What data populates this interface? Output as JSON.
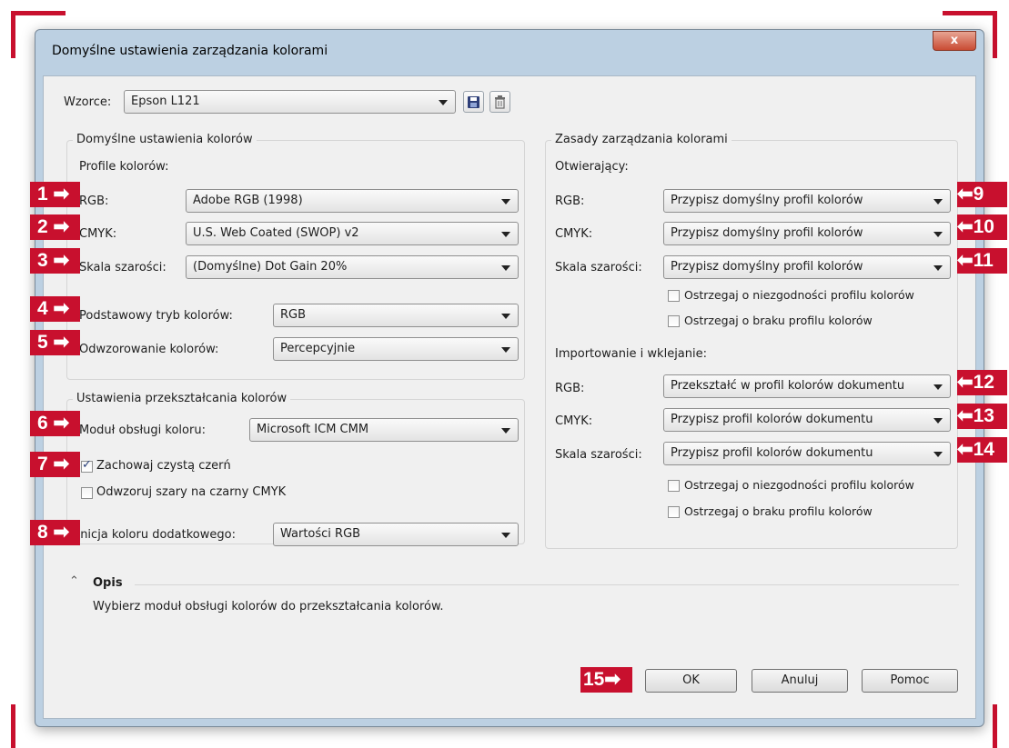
{
  "window": {
    "title": "Domyślne ustawienia zarządzania kolorami",
    "close_glyph": "x"
  },
  "preset": {
    "label": "Wzorce:",
    "value": "Epson L121",
    "save_icon": "save-icon",
    "delete_icon": "trash-icon"
  },
  "defaults_group": {
    "title": "Domyślne ustawienia kolorów",
    "profiles_label": "Profile kolorów:",
    "rgb": {
      "label": "RGB:",
      "value": "Adobe RGB (1998)"
    },
    "cmyk": {
      "label": "CMYK:",
      "value": "U.S. Web Coated (SWOP) v2"
    },
    "gray": {
      "label": "Skala szarości:",
      "value": "(Domyślne) Dot Gain 20%"
    },
    "mode": {
      "label": "Podstawowy tryb kolorów:",
      "value": "RGB"
    },
    "intent": {
      "label": "Odwzorowanie kolorów:",
      "value": "Percepcyjnie"
    }
  },
  "conversion_group": {
    "title": "Ustawienia przekształcania kolorów",
    "engine": {
      "label": "Moduł obsługi koloru:",
      "value": "Microsoft ICM CMM"
    },
    "preserve_black": {
      "label": "Zachowaj czystą czerń",
      "checked": true
    },
    "map_gray": {
      "label": "Odwzoruj szary na czarny CMYK",
      "checked": false
    }
  },
  "spot": {
    "label": "Definicja koloru dodatkowego:",
    "value": "Wartości RGB"
  },
  "policy_group": {
    "title": "Zasady zarządzania kolorami",
    "opening": {
      "title": "Otwierający:",
      "rgb": {
        "label": "RGB:",
        "value": "Przypisz domyślny profil kolorów"
      },
      "cmyk": {
        "label": "CMYK:",
        "value": "Przypisz domyślny profil kolorów"
      },
      "gray": {
        "label": "Skala szarości:",
        "value": "Przypisz domyślny profil kolorów"
      },
      "warn_mismatch": "Ostrzegaj o niezgodności profilu kolorów",
      "warn_missing": "Ostrzegaj o braku profilu kolorów"
    },
    "import": {
      "title": "Importowanie i wklejanie:",
      "rgb": {
        "label": "RGB:",
        "value": "Przekształć w profil kolorów dokumentu"
      },
      "cmyk": {
        "label": "CMYK:",
        "value": "Przypisz profil kolorów dokumentu"
      },
      "gray": {
        "label": "Skala szarości:",
        "value": "Przypisz profil kolorów dokumentu"
      },
      "warn_mismatch": "Ostrzegaj o niezgodności profilu kolorów",
      "warn_missing": "Ostrzegaj o braku profilu kolorów"
    }
  },
  "description": {
    "title": "Opis",
    "text": "Wybierz moduł obsługi kolorów do przekształcania kolorów."
  },
  "buttons": {
    "ok": "OK",
    "cancel": "Anuluj",
    "help": "Pomoc"
  },
  "badges": {
    "b1": "1",
    "b2": "2",
    "b3": "3",
    "b4": "4",
    "b5": "5",
    "b6": "6",
    "b7": "7",
    "b8": "8",
    "b9": "9",
    "b10": "10",
    "b11": "11",
    "b12": "12",
    "b13": "13",
    "b14": "14",
    "b15": "15",
    "arrow_right": "➡",
    "arrow_left": "⬅"
  },
  "colors": {
    "accent": "#c8102e",
    "dialog_bg": "#f0f0f0",
    "frame": "#bcd0e2"
  }
}
